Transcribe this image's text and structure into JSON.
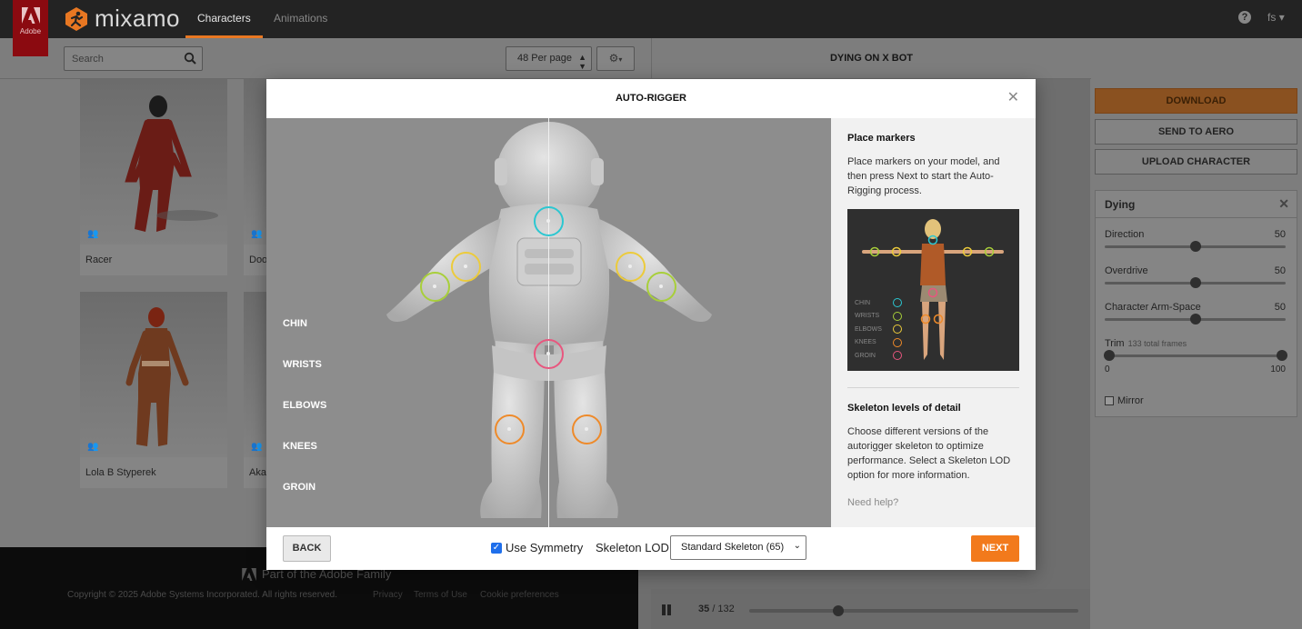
{
  "topbar": {
    "adobe_label": "Adobe",
    "logo_text": "mixamo",
    "tabs": [
      {
        "label": "Characters",
        "active": true
      },
      {
        "label": "Animations",
        "active": false
      }
    ],
    "help_glyph": "?",
    "user": "fs"
  },
  "browser": {
    "search_placeholder": "Search",
    "per_page": "48 Per page",
    "cards": [
      {
        "name": "Racer"
      },
      {
        "name": "Doo"
      },
      {
        "name": "Lola B Styperek"
      },
      {
        "name": "Aka"
      }
    ]
  },
  "footer": {
    "adobe_family": "Part of the Adobe Family",
    "copyright": "Copyright © 2025 Adobe Systems Incorporated. All rights reserved.",
    "links": [
      "Privacy",
      "Terms of Use",
      "Cookie preferences"
    ]
  },
  "viewer": {
    "title": "DYING ON X BOT",
    "frame_current": "35",
    "frame_total": "/ 132",
    "progress_fraction": 0.27
  },
  "sidebar": {
    "download": "DOWNLOAD",
    "send_to_aero": "SEND TO AERO",
    "upload_character": "UPLOAD CHARACTER",
    "animation": {
      "title": "Dying",
      "sliders": [
        {
          "label": "Direction",
          "value": "50"
        },
        {
          "label": "Overdrive",
          "value": "50"
        },
        {
          "label": "Character Arm-Space",
          "value": "50"
        }
      ],
      "trim": {
        "label": "Trim",
        "sub": "133 total frames",
        "min": "0",
        "max": "100"
      },
      "mirror_label": "Mirror"
    }
  },
  "modal": {
    "title": "AUTO-RIGGER",
    "marker_labels": [
      "CHIN",
      "WRISTS",
      "ELBOWS",
      "KNEES",
      "GROIN"
    ],
    "marker_colors": {
      "chin": "#2bc7d1",
      "wrists": "#a8cf3a",
      "elbows": "#eccb3b",
      "knees": "#ee8a2a",
      "groin": "#e8567e"
    },
    "info": {
      "place_title": "Place markers",
      "place_text": "Place markers on your model, and then press Next to start the Auto-Rigging process.",
      "legend": [
        "CHIN",
        "WRISTS",
        "ELBOWS",
        "KNEES",
        "GROIN"
      ],
      "lod_title": "Skeleton levels of detail",
      "lod_text": "Choose different versions of the autorigger skeleton to optimize performance. Select a Skeleton LOD option for more information.",
      "need_help": "Need help?"
    },
    "footer": {
      "back": "BACK",
      "use_symmetry": "Use Symmetry",
      "skeleton_lod_label": "Skeleton LOD",
      "skeleton_lod_value": "Standard Skeleton (65)",
      "next": "NEXT"
    }
  }
}
